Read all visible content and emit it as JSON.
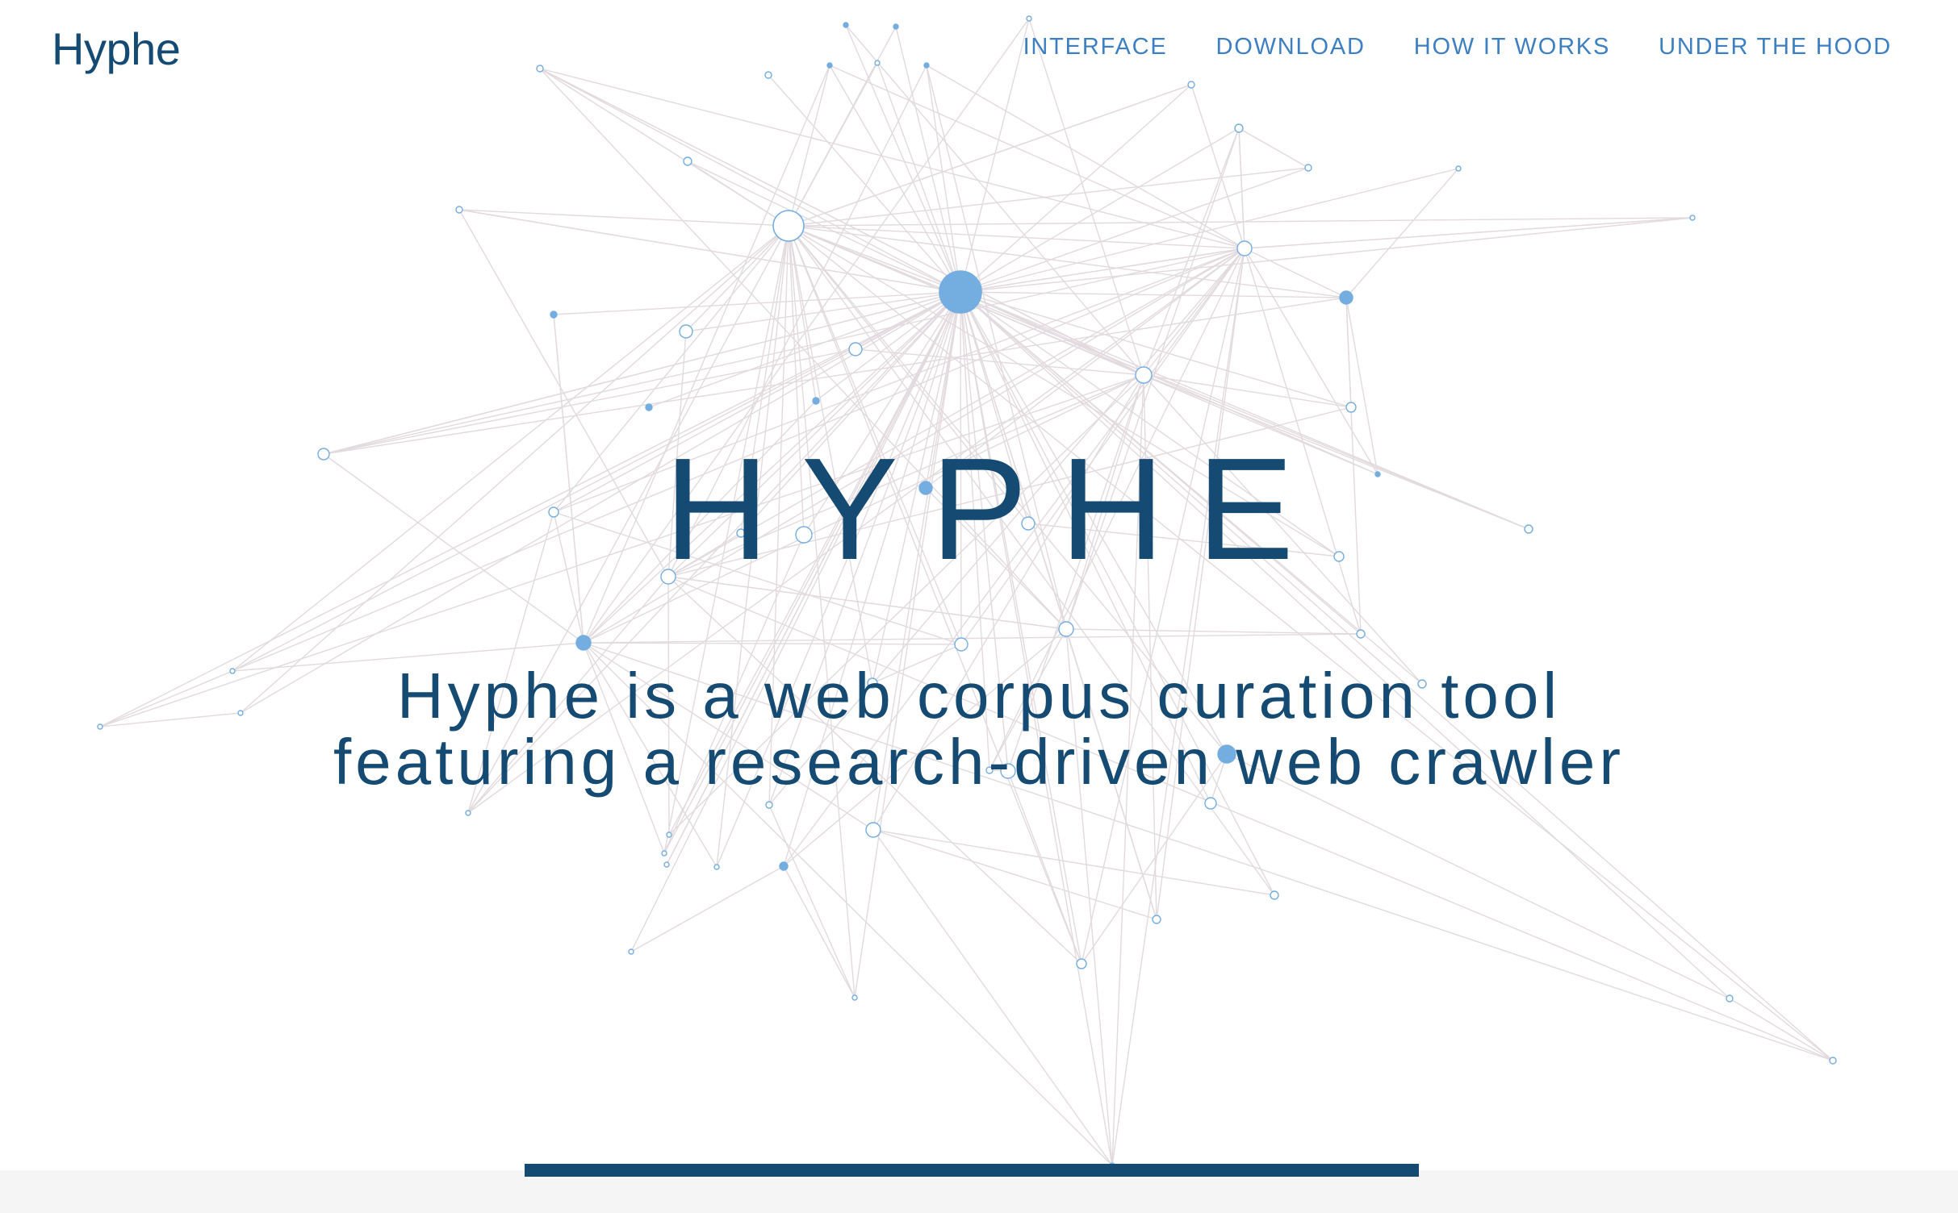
{
  "header": {
    "brand": "Hyphe",
    "nav": [
      {
        "label": "INTERFACE"
      },
      {
        "label": "DOWNLOAD"
      },
      {
        "label": "HOW IT WORKS"
      },
      {
        "label": "UNDER THE HOOD"
      }
    ]
  },
  "hero": {
    "title": "HYPHE",
    "tagline_line1": "Hyphe is a web corpus curation tool",
    "tagline_line2": "featuring a research-driven web crawler"
  },
  "colors": {
    "primary": "#154b73",
    "nav": "#3d7fc1",
    "node": "#74ade0",
    "node_stroke": "#74ade0",
    "edge": "#e2dade",
    "footer": "#f5f5f5"
  }
}
